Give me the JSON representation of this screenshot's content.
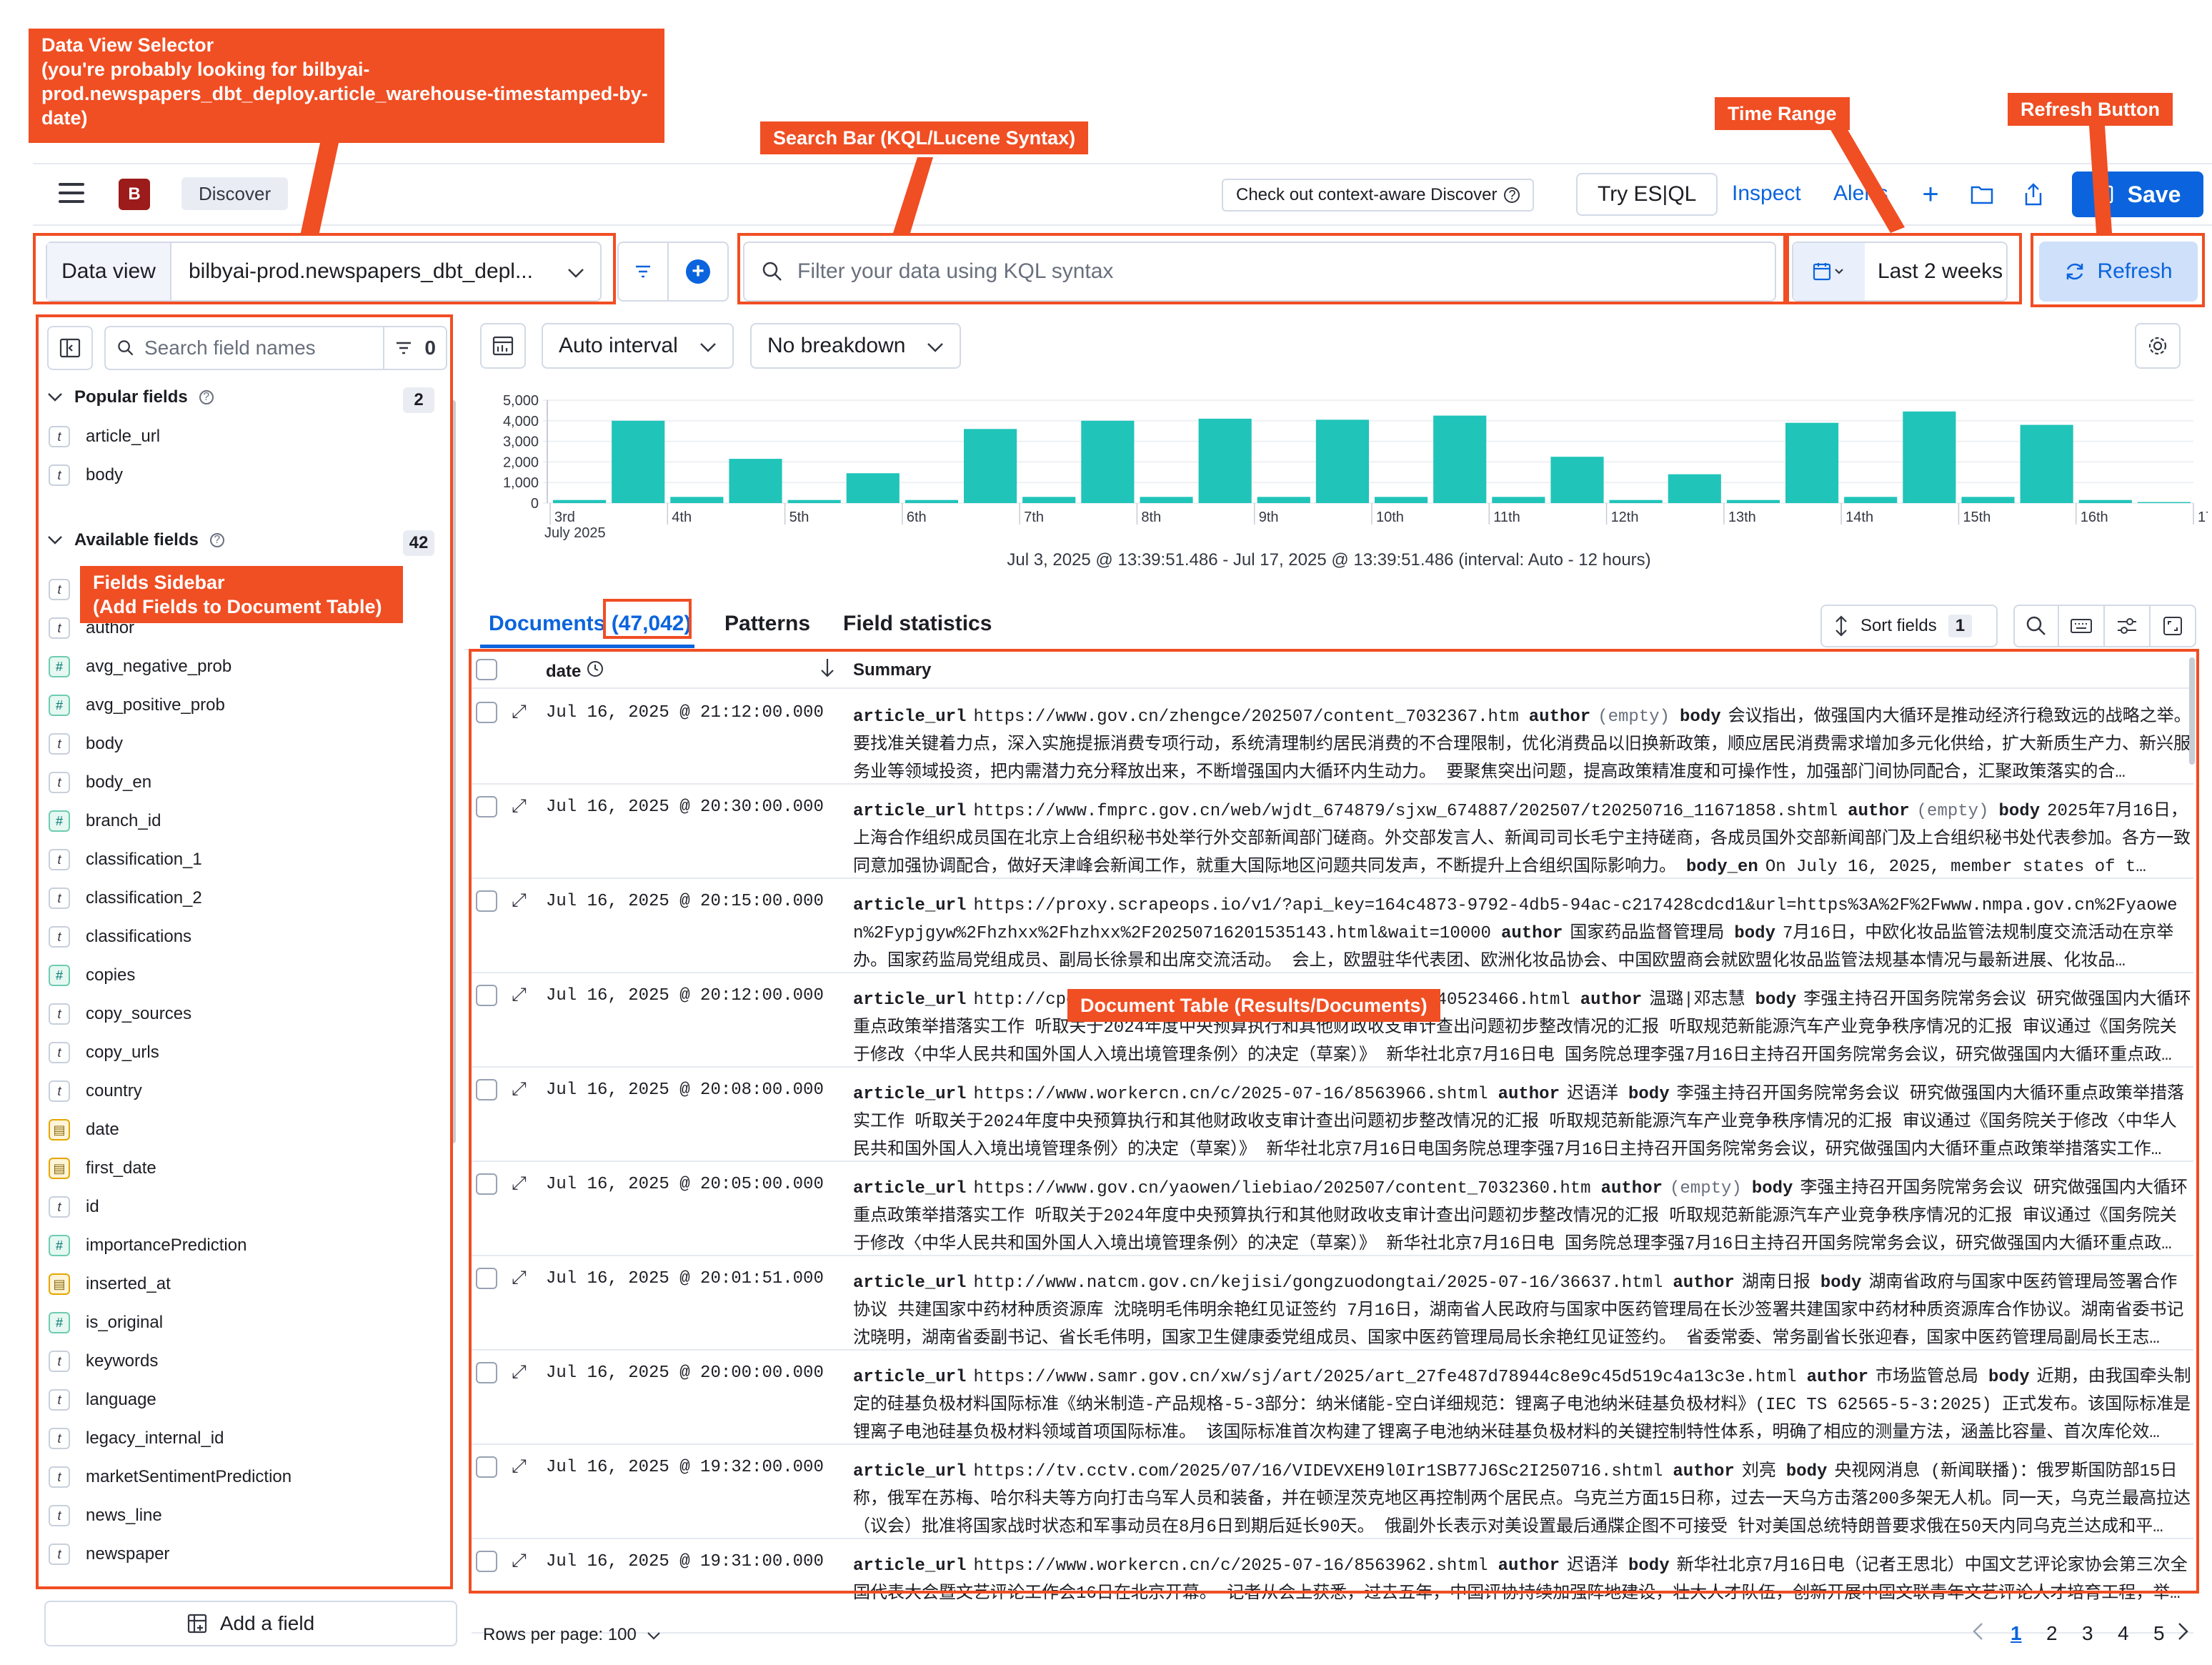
{
  "topbar": {
    "space_initial": "B",
    "breadcrumb": "Discover",
    "context_button": "Check out context-aware Discover",
    "esql_button": "Try ES|QL",
    "inspect": "Inspect",
    "alerts": "Alerts",
    "save": "Save"
  },
  "query": {
    "data_view_label": "Data view",
    "data_view_value": "bilbyai-prod.newspapers_dbt_depl...",
    "search_placeholder": "Filter your data using KQL syntax",
    "time_range": "Last 2 weeks",
    "refresh": "Refresh"
  },
  "sidebar": {
    "search_placeholder": "Search field names",
    "filter_count": "0",
    "popular_title": "Popular fields",
    "popular_count": "2",
    "popular_fields": [
      {
        "name": "article_url",
        "type": "t"
      },
      {
        "name": "body",
        "type": "t"
      }
    ],
    "available_title": "Available fields",
    "available_count": "42",
    "available_fields": [
      {
        "name": "article_url",
        "type": "t"
      },
      {
        "name": "author",
        "type": "t"
      },
      {
        "name": "avg_negative_prob",
        "type": "#"
      },
      {
        "name": "avg_positive_prob",
        "type": "#"
      },
      {
        "name": "body",
        "type": "t"
      },
      {
        "name": "body_en",
        "type": "t"
      },
      {
        "name": "branch_id",
        "type": "#"
      },
      {
        "name": "classification_1",
        "type": "t"
      },
      {
        "name": "classification_2",
        "type": "t"
      },
      {
        "name": "classifications",
        "type": "t"
      },
      {
        "name": "copies",
        "type": "#"
      },
      {
        "name": "copy_sources",
        "type": "t"
      },
      {
        "name": "copy_urls",
        "type": "t"
      },
      {
        "name": "country",
        "type": "t"
      },
      {
        "name": "date",
        "type": "date"
      },
      {
        "name": "first_date",
        "type": "date"
      },
      {
        "name": "id",
        "type": "t"
      },
      {
        "name": "importancePrediction",
        "type": "#"
      },
      {
        "name": "inserted_at",
        "type": "date"
      },
      {
        "name": "is_original",
        "type": "#"
      },
      {
        "name": "keywords",
        "type": "t"
      },
      {
        "name": "language",
        "type": "t"
      },
      {
        "name": "legacy_internal_id",
        "type": "t"
      },
      {
        "name": "marketSentimentPrediction",
        "type": "t"
      },
      {
        "name": "news_line",
        "type": "t"
      },
      {
        "name": "newspaper",
        "type": "t"
      }
    ],
    "add_field": "Add a field"
  },
  "histogram": {
    "interval": "Auto interval",
    "breakdown": "No breakdown",
    "range_text": "Jul 3, 2025 @ 13:39:51.486 - Jul 17, 2025 @ 13:39:51.486 (interval: Auto - 12 hours)",
    "bar_color": "#20c4b9"
  },
  "chart_data": {
    "type": "bar",
    "y_ticks": [
      "5,000",
      "4,000",
      "3,000",
      "2,000",
      "1,000",
      "0"
    ],
    "ylim": [
      0,
      5000
    ],
    "x_ticks": [
      "3rd",
      "4th",
      "5th",
      "6th",
      "7th",
      "8th",
      "9th",
      "10th",
      "11th",
      "12th",
      "13th",
      "14th",
      "15th",
      "16th",
      "17th"
    ],
    "x_subtitle": "July 2025",
    "values": [
      150,
      4000,
      300,
      2150,
      150,
      1450,
      150,
      3600,
      300,
      4000,
      300,
      4100,
      300,
      4050,
      300,
      4250,
      300,
      2250,
      150,
      1400,
      150,
      3900,
      300,
      4450,
      300,
      3800,
      150,
      50
    ]
  },
  "tabs": {
    "documents": "Documents",
    "documents_count": "(47,042)",
    "patterns": "Patterns",
    "field_statistics": "Field statistics",
    "sort_fields": "Sort fields",
    "sort_count": "1"
  },
  "table": {
    "col_date": "date",
    "col_summary": "Summary",
    "rows": [
      {
        "date": "Jul 16, 2025 @ 21:12:00.000",
        "url": "https://www.gov.cn/zhengce/202507/content_7032367.htm",
        "author": "(empty)",
        "author_empty": true,
        "body": "会议指出，做强国内大循环是推动经济行稳致远的战略之举。 要找准关键着力点，深入实施提振消费专项行动，系统清理制约居民消费的不合理限制，优化消费品以旧换新政策，顺应居民消费需求增加多元化供给，扩大新质生产力、新兴服务业等领域投资，把内需潜力充分释放出来，不断增强国内大循环内生动力。 要聚焦突出问题，提高政策精准度和可操作性，加强部门间协同配合，汇聚政策落实的合…"
      },
      {
        "date": "Jul 16, 2025 @ 20:30:00.000",
        "url": "https://www.fmprc.gov.cn/web/wjdt_674879/sjxw_674887/202507/t20250716_11671858.shtml",
        "author": "(empty)",
        "author_empty": true,
        "body": "2025年7月16日，上海合作组织成员国在北京上合组织秘书处举行外交部新闻部门磋商。外交部发言人、新闻司司长毛宁主持磋商，各成员国外交部新闻部门及上合组织秘书处代表参加。各方一致同意加强协调配合，做好天津峰会新闻工作，就重大国际地区问题共同发声，不断提升上合组织国际影响力。",
        "extra_label": "body_en",
        "extra": "On July 16, 2025, member states of t…"
      },
      {
        "date": "Jul 16, 2025 @ 20:15:00.000",
        "url": "https://proxy.scrapeops.io/v1/?api_key=164c4873-9792-4db5-94ac-c217428cdcd1&url=https%3A%2F%2Fwww.nmpa.gov.cn%2Fyaowen%2Fypjgyw%2Fhzhxx%2Fhzhxx%2F20250716201535143.html&wait=10000",
        "author": "国家药品监督管理局",
        "body": "7月16日，中欧化妆品监管法规制度交流活动在京举办。国家药监局党组成员、副局长徐景和出席交流活动。 会上，欧盟驻华代表团、欧洲化妆品协会、中国欧盟商会就欧盟化妆品监管法规基本情况与最新进展、化妆品…"
      },
      {
        "date": "Jul 16, 2025 @ 20:12:00.000",
        "url": "http://cpc.people.com.cn/n1/2025/0716/c64094-40523466.html",
        "author": "温璐|邓志慧",
        "body": "李强主持召开国务院常务会议 研究做强国内大循环重点政策举措落实工作 听取关于2024年度中央预算执行和其他财政收支审计查出问题初步整改情况的汇报 听取规范新能源汽车产业竞争秩序情况的汇报 审议通过《国务院关于修改〈中华人民共和国外国人入境出境管理条例〉的决定（草案）》 新华社北京7月16日电 国务院总理李强7月16日主持召开国务院常务会议，研究做强国内大循环重点政…"
      },
      {
        "date": "Jul 16, 2025 @ 20:08:00.000",
        "url": "https://www.workercn.cn/c/2025-07-16/8563966.shtml",
        "author": "迟语洋",
        "body": "李强主持召开国务院常务会议 研究做强国内大循环重点政策举措落实工作 听取关于2024年度中央预算执行和其他财政收支审计查出问题初步整改情况的汇报 听取规范新能源汽车产业竞争秩序情况的汇报 审议通过《国务院关于修改〈中华人民共和国外国人入境出境管理条例〉的决定（草案）》 新华社北京7月16日电国务院总理李强7月16日主持召开国务院常务会议，研究做强国内大循环重点政策举措落实工作…"
      },
      {
        "date": "Jul 16, 2025 @ 20:05:00.000",
        "url": "https://www.gov.cn/yaowen/liebiao/202507/content_7032360.htm",
        "author": "(empty)",
        "author_empty": true,
        "body": "李强主持召开国务院常务会议 研究做强国内大循环重点政策举措落实工作 听取关于2024年度中央预算执行和其他财政收支审计查出问题初步整改情况的汇报 听取规范新能源汽车产业竞争秩序情况的汇报 审议通过《国务院关于修改〈中华人民共和国外国人入境出境管理条例〉的决定（草案）》 新华社北京7月16日电 国务院总理李强7月16日主持召开国务院常务会议，研究做强国内大循环重点政…"
      },
      {
        "date": "Jul 16, 2025 @ 20:01:51.000",
        "url": "http://www.natcm.gov.cn/kejisi/gongzuodongtai/2025-07-16/36637.html",
        "author": "湖南日报",
        "body": "湖南省政府与国家中医药管理局签署合作协议 共建国家中药材种质资源库 沈晓明毛伟明余艳红见证签约 7月16日，湖南省人民政府与国家中医药管理局在长沙签署共建国家中药材种质资源库合作协议。湖南省委书记沈晓明，湖南省委副书记、省长毛伟明，国家卫生健康委党组成员、国家中医药管理局局长余艳红见证签约。 省委常委、常务副省长张迎春，国家中医药管理局副局长王志…"
      },
      {
        "date": "Jul 16, 2025 @ 20:00:00.000",
        "url": "https://www.samr.gov.cn/xw/sj/art/2025/art_27fe487d78944c8e9c45d519c4a13c3e.html",
        "author": "市场监管总局",
        "body": "近期，由我国牵头制定的硅基负极材料国际标准《纳米制造-产品规格-5-3部分：纳米储能-空白详细规范：锂离子电池纳米硅基负极材料》(IEC TS 62565-5-3:2025) 正式发布。该国际标准是锂离子电池硅基负极材料领域首项国际标准。 该国际标准首次构建了锂离子电池纳米硅基负极材料的关键控制特性体系，明确了相应的测量方法，涵盖比容量、首次库伦效…"
      },
      {
        "date": "Jul 16, 2025 @ 19:32:00.000",
        "url": "https://tv.cctv.com/2025/07/16/VIDEVXEH9l0Ir1SB77J6Sc2I250716.shtml",
        "author": "刘亮",
        "body": "央视网消息 (新闻联播)：俄罗斯国防部15日称，俄军在苏梅、哈尔科夫等方向打击乌军人员和装备，并在顿涅茨克地区再控制两个居民点。乌克兰方面15日称，过去一天乌方击落200多架无人机。同一天，乌克兰最高拉达（议会）批准将国家战时状态和军事动员在8月6日到期后延长90天。 俄副外长表示对美设置最后通牒企图不可接受 针对美国总统特朗普要求俄在50天内同乌克兰达成和平…"
      },
      {
        "date": "Jul 16, 2025 @ 19:31:00.000",
        "url": "https://www.workercn.cn/c/2025-07-16/8563962.shtml",
        "author": "迟语洋",
        "body": "新华社北京7月16日电（记者王思北）中国文艺评论家协会第三次全国代表大会暨文艺评论工作会16日在北京开幕。 记者从会上获悉，过去五年，中国评协持续加强阵地建设，壮大人才队伍，创新开展中国文联青年文艺评论人才培育工程，举…"
      }
    ]
  },
  "footer": {
    "rows_per_page": "Rows per page: 100",
    "pages": [
      "1",
      "2",
      "3",
      "4",
      "5"
    ]
  },
  "annotations": {
    "data_view": "Data View Selector\n(you're probably looking for bilbyai-prod.newspapers_dbt_deploy.article_warehouse-timestamped-by-date)",
    "search": "Search Bar (KQL/Lucene Syntax)",
    "time": "Time Range",
    "refresh": "Refresh Button",
    "sidebar": "Fields Sidebar\n(Add Fields to Document Table)",
    "table": "Document Table (Results/Documents)",
    "color": "#f04e23"
  }
}
